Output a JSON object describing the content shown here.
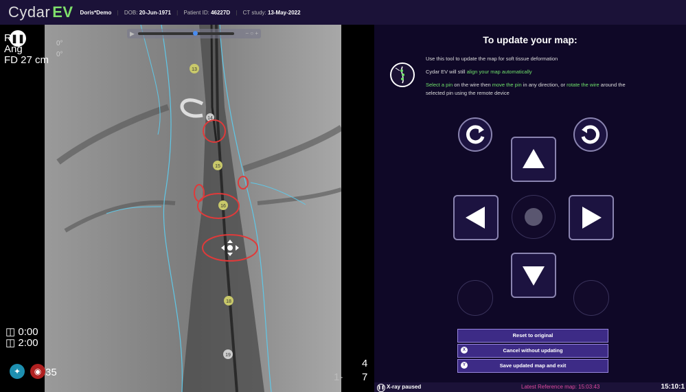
{
  "app": {
    "logo_main": "Cydar",
    "logo_ev": "EV"
  },
  "patient": {
    "name": "Doris*Demo",
    "dob_label": "DOB:",
    "dob": "20-Jun-1971",
    "id_label": "Patient ID:",
    "id": "46227D",
    "ct_label": "CT study:",
    "ct_date": "13-May-2022"
  },
  "xray": {
    "overlay_left": [
      "R",
      "Ang",
      "FD 27 cm"
    ],
    "overlay_deg": [
      "0°",
      "0°"
    ],
    "time_1": "0:00",
    "time_2": "2:00",
    "bottom_num": "35",
    "right_nums": [
      "4",
      "7"
    ],
    "right_dash": "1-",
    "landmarks": [
      "13",
      "14",
      "15",
      "16",
      "18",
      "19"
    ]
  },
  "update_panel": {
    "title": "To update your map:",
    "line1": "Use this tool to update the map for soft tissue deformation",
    "line2_a": "Cydar EV will still ",
    "line2_b": "align your map automatically",
    "line3_a": "Select a pin",
    "line3_b": " on the wire then ",
    "line3_c": "move the pin",
    "line3_d": " in any direction, or ",
    "line3_e": "rotate the wire",
    "line3_f": " around the selected pin using the remote device",
    "reset_label": "Reset to original",
    "cancel_label": "Cancel without updating",
    "cancel_key": "X",
    "save_label": "Save updated map and exit",
    "save_key": "Y"
  },
  "status": {
    "xray_paused": "X-ray paused",
    "ref_map": "Latest Reference map: 15:03:43",
    "clock": "15:10:1"
  },
  "colors": {
    "accent_green": "#6fe06a",
    "vessel_cyan": "#5fc8e8",
    "pin_red": "#e03a3a",
    "bg_panel": "#0f0827"
  }
}
